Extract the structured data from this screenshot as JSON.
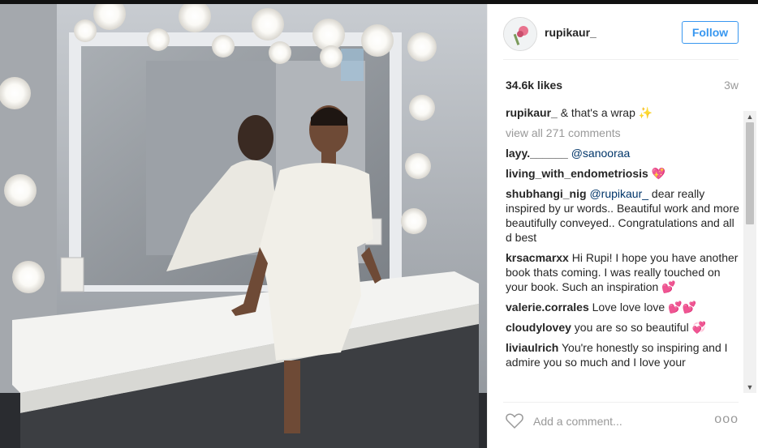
{
  "post": {
    "username": "rupikaur_",
    "follow_label": "Follow",
    "likes": "34.6k likes",
    "age": "3w",
    "caption_user": "rupikaur_",
    "caption_text": " & that's a wrap ✨",
    "view_all": "view all 271 comments",
    "comments": [
      {
        "user": "layy.______",
        "mention": "@sanooraa",
        "text": ""
      },
      {
        "user": "living_with_endometriosis",
        "mention": "",
        "text": " 💖"
      },
      {
        "user": "shubhangi_nig",
        "mention": "@rupikaur_",
        "text": " dear really inspired by ur words.. Beautiful work and more beautifully conveyed.. Congratulations and all d best"
      },
      {
        "user": "krsacmarxx",
        "mention": "",
        "text": " Hi Rupi! I hope you have another book thats coming. I was really touched on your book. Such an inspiration 💕"
      },
      {
        "user": "valerie.corrales",
        "mention": "",
        "text": " Love love love 💕💕"
      },
      {
        "user": "cloudylovey",
        "mention": "",
        "text": " you are so so beautiful 💞"
      },
      {
        "user": "liviaulrich",
        "mention": "",
        "text": " You're honestly so inspiring and I admire you so much and I love your"
      }
    ],
    "add_comment_placeholder": "Add a comment...",
    "more_label": "ooo"
  },
  "icons": {
    "heart": "heart-icon",
    "more": "more-options-icon",
    "sparkles": "sparkles-emoji"
  },
  "colors": {
    "accent": "#3897f0",
    "mention": "#003569",
    "muted": "#999999"
  }
}
